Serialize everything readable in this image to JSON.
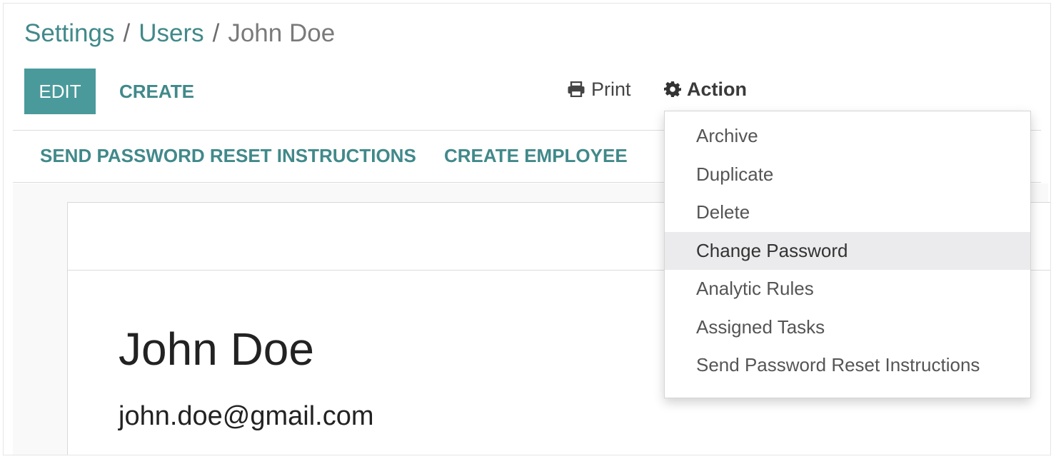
{
  "breadcrumb": {
    "items": [
      "Settings",
      "Users"
    ],
    "separator": "/",
    "current": "John Doe"
  },
  "toolbar": {
    "edit_label": "EDIT",
    "create_label": "CREATE",
    "print_label": "Print",
    "print_icon": "printer-icon",
    "action_label": "Action",
    "action_icon": "gear-icon"
  },
  "statusbar": {
    "reset_label": "SEND PASSWORD RESET INSTRUCTIONS",
    "employee_label": "CREATE EMPLOYEE"
  },
  "record": {
    "name": "John Doe",
    "email": "john.doe@gmail.com"
  },
  "action_menu": {
    "items": [
      "Archive",
      "Duplicate",
      "Delete",
      "Change Password",
      "Analytic Rules",
      "Assigned Tasks",
      "Send Password Reset Instructions"
    ],
    "highlighted": "Change Password"
  },
  "colors": {
    "accent": "#41898a",
    "edit_button_bg": "#4a9a9b",
    "menu_highlight": "#ebebed"
  }
}
